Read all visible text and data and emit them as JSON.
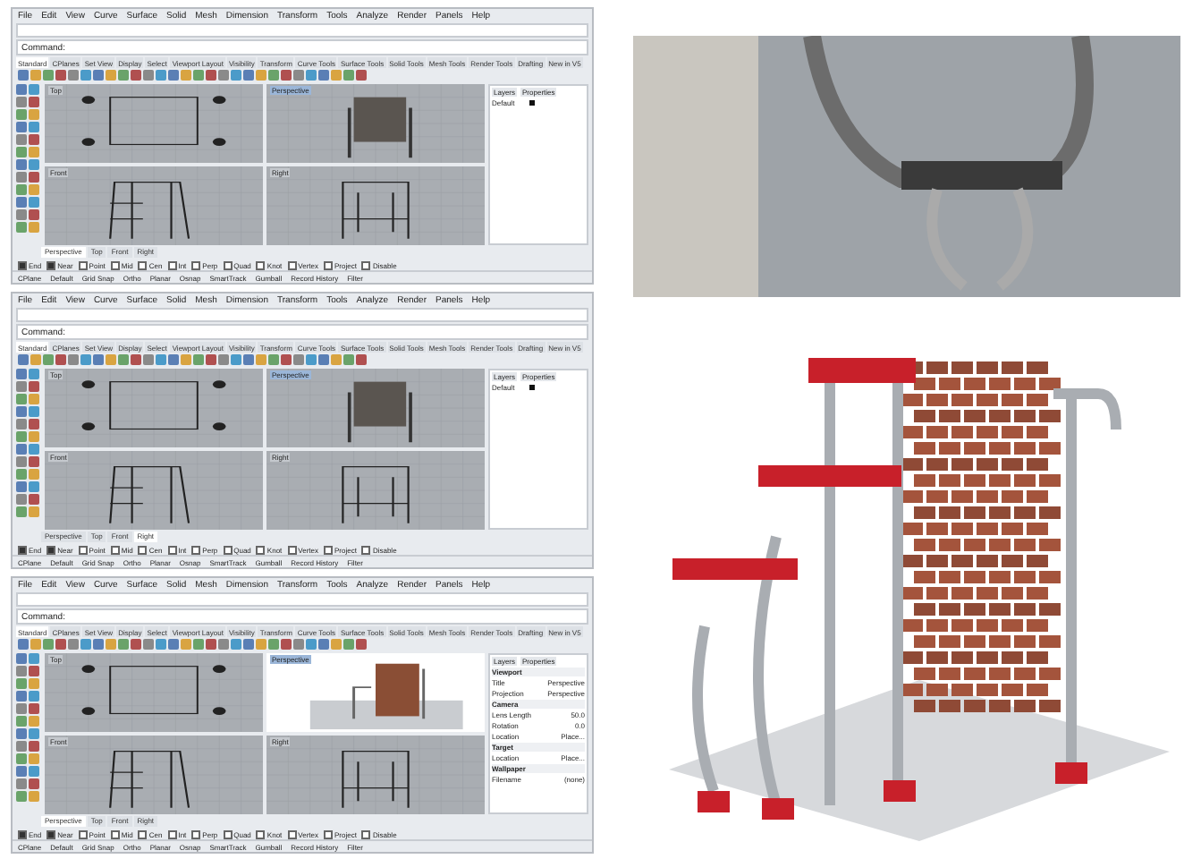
{
  "windows": [
    {
      "menu": [
        "File",
        "Edit",
        "View",
        "Curve",
        "Surface",
        "Solid",
        "Mesh",
        "Dimension",
        "Transform",
        "Tools",
        "Analyze",
        "Render",
        "Panels",
        "Help"
      ],
      "command_label": "Command:",
      "toolbar_tabs": [
        {
          "label": "Standard",
          "selected": true
        },
        {
          "label": "CPlanes",
          "selected": false
        },
        {
          "label": "Set View",
          "selected": false
        },
        {
          "label": "Display",
          "selected": false
        },
        {
          "label": "Select",
          "selected": false
        },
        {
          "label": "Viewport Layout",
          "selected": false
        },
        {
          "label": "Visibility",
          "selected": false
        },
        {
          "label": "Transform",
          "selected": false
        },
        {
          "label": "Curve Tools",
          "selected": false
        },
        {
          "label": "Surface Tools",
          "selected": false
        },
        {
          "label": "Solid Tools",
          "selected": false
        },
        {
          "label": "Mesh Tools",
          "selected": false
        },
        {
          "label": "Render Tools",
          "selected": false
        },
        {
          "label": "Drafting",
          "selected": false
        },
        {
          "label": "New in V5",
          "selected": false
        }
      ],
      "viewports": [
        {
          "label": "Top",
          "kind": "top"
        },
        {
          "label": "Perspective",
          "kind": "shaded"
        },
        {
          "label": "Front",
          "kind": "front"
        },
        {
          "label": "Right",
          "kind": "right"
        }
      ],
      "viewport_tabs": [
        {
          "label": "Perspective",
          "selected": true
        },
        {
          "label": "Top",
          "selected": false
        },
        {
          "label": "Front",
          "selected": false
        },
        {
          "label": "Right",
          "selected": false
        }
      ],
      "panel": {
        "kind": "layers",
        "tabs": [
          "Layers",
          "Properties"
        ],
        "rows": [
          {
            "label": "Default"
          }
        ]
      },
      "osnaps": [
        {
          "label": "End",
          "checked": true
        },
        {
          "label": "Near",
          "checked": true
        },
        {
          "label": "Point",
          "checked": false
        },
        {
          "label": "Mid",
          "checked": false
        },
        {
          "label": "Cen",
          "checked": false
        },
        {
          "label": "Int",
          "checked": false
        },
        {
          "label": "Perp",
          "checked": false
        },
        {
          "label": "Quad",
          "checked": false
        },
        {
          "label": "Knot",
          "checked": false
        },
        {
          "label": "Vertex",
          "checked": false
        },
        {
          "label": "Project",
          "checked": false
        },
        {
          "label": "Disable",
          "checked": false
        }
      ],
      "status": [
        "CPlane",
        "Default",
        "Grid Snap",
        "Ortho",
        "Planar",
        "Osnap",
        "SmartTrack",
        "Gumball",
        "Record History",
        "Filter"
      ]
    },
    {
      "menu": [
        "File",
        "Edit",
        "View",
        "Curve",
        "Surface",
        "Solid",
        "Mesh",
        "Dimension",
        "Transform",
        "Tools",
        "Analyze",
        "Render",
        "Panels",
        "Help"
      ],
      "command_label": "Command:",
      "toolbar_tabs": [
        {
          "label": "Standard",
          "selected": true
        },
        {
          "label": "CPlanes",
          "selected": false
        },
        {
          "label": "Set View",
          "selected": false
        },
        {
          "label": "Display",
          "selected": false
        },
        {
          "label": "Select",
          "selected": false
        },
        {
          "label": "Viewport Layout",
          "selected": false
        },
        {
          "label": "Visibility",
          "selected": false
        },
        {
          "label": "Transform",
          "selected": false
        },
        {
          "label": "Curve Tools",
          "selected": false
        },
        {
          "label": "Surface Tools",
          "selected": false
        },
        {
          "label": "Solid Tools",
          "selected": false
        },
        {
          "label": "Mesh Tools",
          "selected": false
        },
        {
          "label": "Render Tools",
          "selected": false
        },
        {
          "label": "Drafting",
          "selected": false
        },
        {
          "label": "New in V5",
          "selected": false
        }
      ],
      "viewports": [
        {
          "label": "Top",
          "kind": "top"
        },
        {
          "label": "Perspective",
          "kind": "shaded"
        },
        {
          "label": "Front",
          "kind": "front"
        },
        {
          "label": "Right",
          "kind": "right"
        }
      ],
      "viewport_tabs": [
        {
          "label": "Perspective",
          "selected": false
        },
        {
          "label": "Top",
          "selected": false
        },
        {
          "label": "Front",
          "selected": false
        },
        {
          "label": "Right",
          "selected": true
        }
      ],
      "panel": {
        "kind": "layers",
        "tabs": [
          "Layers",
          "Properties"
        ],
        "rows": [
          {
            "label": "Default"
          }
        ]
      },
      "osnaps": [
        {
          "label": "End",
          "checked": true
        },
        {
          "label": "Near",
          "checked": true
        },
        {
          "label": "Point",
          "checked": false
        },
        {
          "label": "Mid",
          "checked": false
        },
        {
          "label": "Cen",
          "checked": false
        },
        {
          "label": "Int",
          "checked": false
        },
        {
          "label": "Perp",
          "checked": false
        },
        {
          "label": "Quad",
          "checked": false
        },
        {
          "label": "Knot",
          "checked": false
        },
        {
          "label": "Vertex",
          "checked": false
        },
        {
          "label": "Project",
          "checked": false
        },
        {
          "label": "Disable",
          "checked": false
        }
      ],
      "status": [
        "CPlane",
        "Default",
        "Grid Snap",
        "Ortho",
        "Planar",
        "Osnap",
        "SmartTrack",
        "Gumball",
        "Record History",
        "Filter"
      ]
    },
    {
      "menu": [
        "File",
        "Edit",
        "View",
        "Curve",
        "Surface",
        "Solid",
        "Mesh",
        "Dimension",
        "Transform",
        "Tools",
        "Analyze",
        "Render",
        "Panels",
        "Help"
      ],
      "command_label": "Command:",
      "toolbar_tabs": [
        {
          "label": "Standard",
          "selected": true
        },
        {
          "label": "CPlanes",
          "selected": false
        },
        {
          "label": "Set View",
          "selected": false
        },
        {
          "label": "Display",
          "selected": false
        },
        {
          "label": "Select",
          "selected": false
        },
        {
          "label": "Viewport Layout",
          "selected": false
        },
        {
          "label": "Visibility",
          "selected": false
        },
        {
          "label": "Transform",
          "selected": false
        },
        {
          "label": "Curve Tools",
          "selected": false
        },
        {
          "label": "Surface Tools",
          "selected": false
        },
        {
          "label": "Solid Tools",
          "selected": false
        },
        {
          "label": "Mesh Tools",
          "selected": false
        },
        {
          "label": "Render Tools",
          "selected": false
        },
        {
          "label": "Drafting",
          "selected": false
        },
        {
          "label": "New in V5",
          "selected": false
        }
      ],
      "viewports": [
        {
          "label": "Top",
          "kind": "top"
        },
        {
          "label": "Perspective",
          "kind": "rendered"
        },
        {
          "label": "Front",
          "kind": "front"
        },
        {
          "label": "Right",
          "kind": "right"
        }
      ],
      "viewport_tabs": [
        {
          "label": "Perspective",
          "selected": true
        },
        {
          "label": "Top",
          "selected": false
        },
        {
          "label": "Front",
          "selected": false
        },
        {
          "label": "Right",
          "selected": false
        }
      ],
      "panel": {
        "kind": "properties",
        "tabs": [
          "Layers",
          "Properties"
        ],
        "rows": [
          {
            "label": "Viewport",
            "kind": "heading"
          },
          {
            "label": "Title",
            "value": "Perspective"
          },
          {
            "label": "Projection",
            "value": "Perspective"
          },
          {
            "label": "Camera",
            "kind": "heading"
          },
          {
            "label": "Lens Length",
            "value": "50.0"
          },
          {
            "label": "Rotation",
            "value": "0.0"
          },
          {
            "label": "Location",
            "value": "Place..."
          },
          {
            "label": "Target",
            "kind": "heading"
          },
          {
            "label": "Location",
            "value": "Place..."
          },
          {
            "label": "Wallpaper",
            "kind": "heading"
          },
          {
            "label": "Filename",
            "value": "(none)"
          }
        ]
      },
      "osnaps": [
        {
          "label": "End",
          "checked": true
        },
        {
          "label": "Near",
          "checked": true
        },
        {
          "label": "Point",
          "checked": false
        },
        {
          "label": "Mid",
          "checked": false
        },
        {
          "label": "Cen",
          "checked": false
        },
        {
          "label": "Int",
          "checked": false
        },
        {
          "label": "Perp",
          "checked": false
        },
        {
          "label": "Quad",
          "checked": false
        },
        {
          "label": "Knot",
          "checked": false
        },
        {
          "label": "Vertex",
          "checked": false
        },
        {
          "label": "Project",
          "checked": false
        },
        {
          "label": "Disable",
          "checked": false
        }
      ],
      "status": [
        "CPlane",
        "Default",
        "Grid Snap",
        "Ortho",
        "Planar",
        "Osnap",
        "SmartTrack",
        "Gumball",
        "Record History",
        "Filter"
      ]
    }
  ]
}
